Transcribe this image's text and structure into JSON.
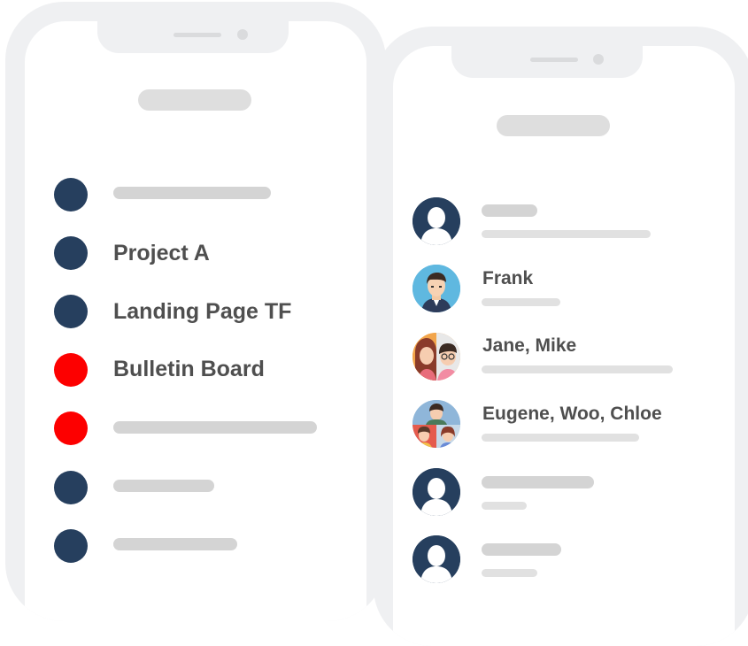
{
  "colors": {
    "dot_blue": "#263f5e",
    "dot_red": "#fd0000",
    "frame": "#eff0f2",
    "placeholder": "#d4d4d4",
    "label": "#4f4f4f"
  },
  "project_list": {
    "items": [
      {
        "label": "",
        "dot_color": "#263f5e"
      },
      {
        "label": "Project A",
        "dot_color": "#263f5e"
      },
      {
        "label": "Landing Page TF",
        "dot_color": "#263f5e"
      },
      {
        "label": "Bulletin Board",
        "dot_color": "#fd0000"
      },
      {
        "label": "",
        "dot_color": "#fd0000"
      },
      {
        "label": "",
        "dot_color": "#263f5e"
      },
      {
        "label": "",
        "dot_color": "#263f5e"
      }
    ]
  },
  "contact_list": {
    "items": [
      {
        "name": "",
        "avatar": "default-user-icon"
      },
      {
        "name": "Frank",
        "avatar": "frank-avatar"
      },
      {
        "name": "Jane, Mike",
        "avatar": "group-avatar-two"
      },
      {
        "name": "Eugene, Woo, Chloe",
        "avatar": "group-avatar-three"
      },
      {
        "name": "",
        "avatar": "default-user-icon"
      },
      {
        "name": "",
        "avatar": "default-user-icon"
      }
    ]
  }
}
